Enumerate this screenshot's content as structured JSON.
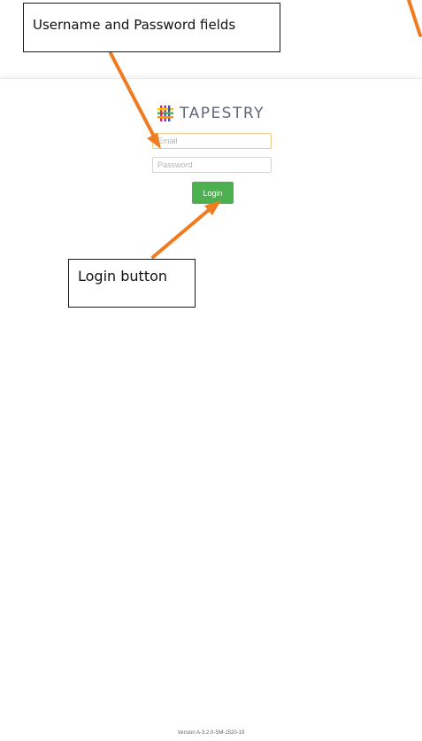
{
  "annotations": {
    "fields_note": "Username and Password fields",
    "login_note": "Login button",
    "arrow_color": "#f07c22"
  },
  "app": {
    "brand": "TAPESTRY",
    "logo_icon": "tapestry-weave-icon",
    "email": {
      "value": "",
      "placeholder": "Email"
    },
    "password": {
      "value": "",
      "placeholder": "Password"
    },
    "login_label": "Login",
    "login_color": "#4caf50",
    "version": "Version A-3.2.0-SM-1520-19"
  }
}
